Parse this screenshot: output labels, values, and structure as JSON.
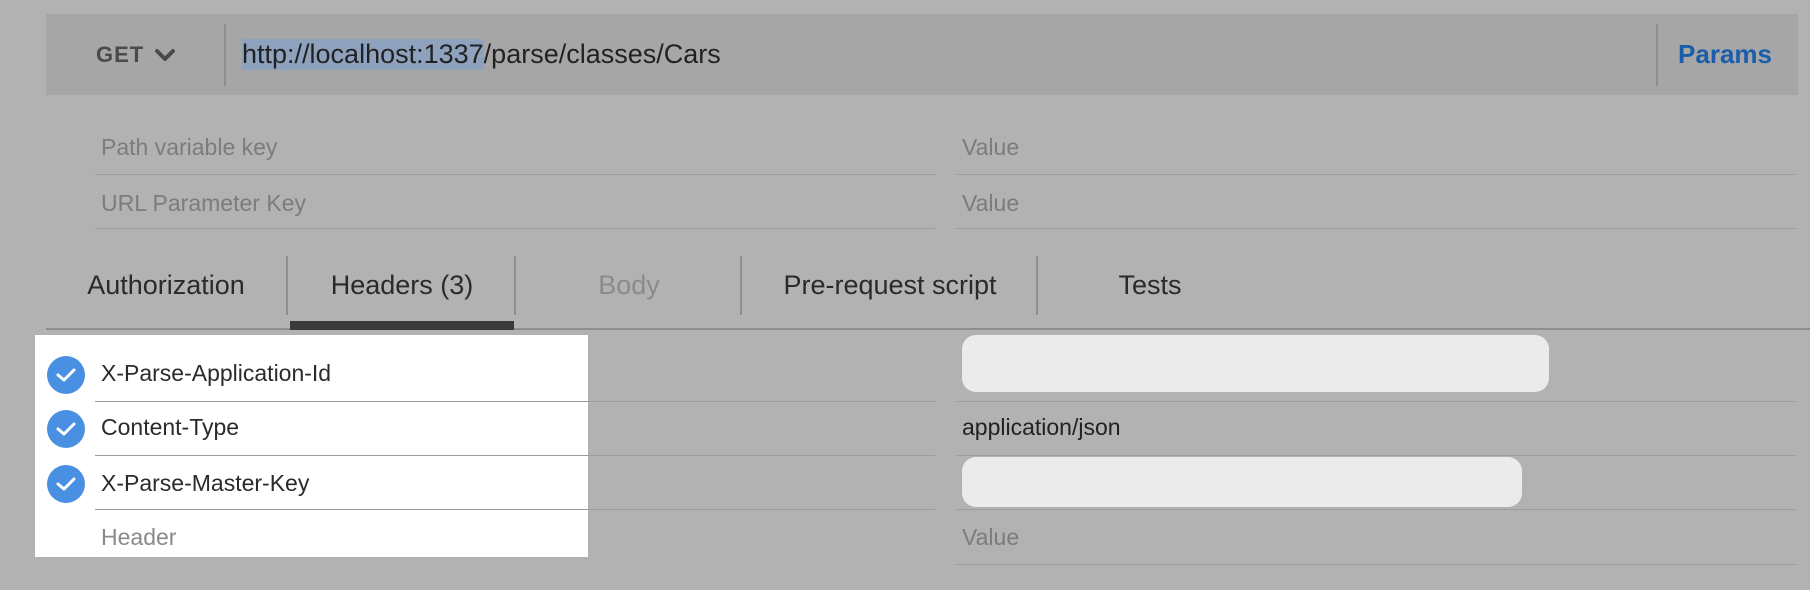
{
  "request": {
    "method": "GET",
    "url_highlighted": "http://localhost:1337",
    "url_rest": "/parse/classes/Cars",
    "params_label": "Params"
  },
  "path_variables": {
    "key_placeholder": "Path variable key",
    "value_placeholder": "Value"
  },
  "url_params": {
    "key_placeholder": "URL Parameter Key",
    "value_placeholder": "Value"
  },
  "tabs": [
    {
      "label": "Authorization"
    },
    {
      "label": "Headers (3)"
    },
    {
      "label": "Body"
    },
    {
      "label": "Pre-request script"
    },
    {
      "label": "Tests"
    }
  ],
  "headers": [
    {
      "key": "X-Parse-Application-Id",
      "value": ""
    },
    {
      "key": "Content-Type",
      "value": "application/json"
    },
    {
      "key": "X-Parse-Master-Key",
      "value": ""
    }
  ],
  "new_header": {
    "key_placeholder": "Header",
    "value_placeholder": "Value"
  },
  "colors": {
    "accent": "#4a90e2",
    "link": "#1a5dab"
  },
  "icons": {
    "method_dropdown": "chevron-down-icon",
    "header_enabled": "checkmark-icon"
  }
}
